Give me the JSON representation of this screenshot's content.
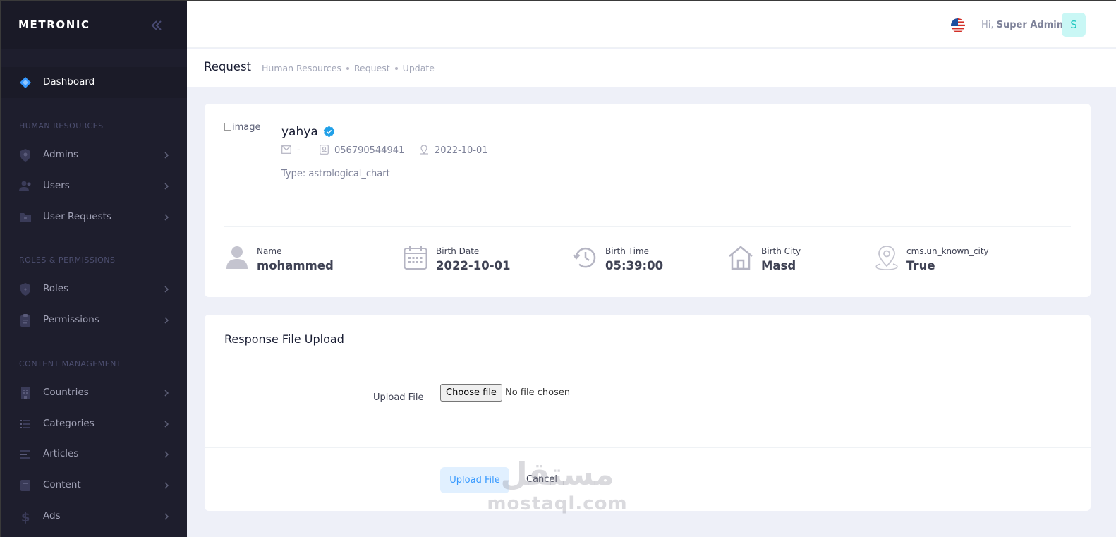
{
  "sidebar": {
    "brand": "METRONIC",
    "dashboard": "Dashboard",
    "sections": {
      "hr": "HUMAN RESOURCES",
      "roles": "ROLES & PERMISSIONS",
      "content": "CONTENT MANAGEMENT"
    },
    "items": {
      "admins": "Admins",
      "users": "Users",
      "user_requests": "User Requests",
      "roles": "Roles",
      "permissions": "Permissions",
      "countries": "Countries",
      "categories": "Categories",
      "articles": "Articles",
      "content": "Content",
      "ads": "Ads"
    }
  },
  "header": {
    "greet_prefix": "Hi,",
    "user_name": "Super Admin",
    "avatar_letter": "S"
  },
  "toolbar": {
    "title": "Request",
    "breadcrumbs": [
      "Human Resources",
      "Request",
      "Update"
    ]
  },
  "profile": {
    "image_alt": "image",
    "name": "yahya",
    "email": "-",
    "phone": "056790544941",
    "date": "2022-10-01",
    "type_label": "Type:",
    "type_value": "astrological_chart"
  },
  "stats": [
    {
      "label": "Name",
      "value": "mohammed",
      "icon": "person-icon"
    },
    {
      "label": "Birth Date",
      "value": "2022-10-01",
      "icon": "calendar-icon"
    },
    {
      "label": "Birth Time",
      "value": "05:39:00",
      "icon": "history-icon"
    },
    {
      "label": "Birth City",
      "value": "Masd",
      "icon": "home-icon"
    },
    {
      "label": "cms.un_known_city",
      "value": "True",
      "icon": "location-icon"
    }
  ],
  "upload": {
    "title": "Response File Upload",
    "field_label": "Upload File",
    "choose_label": "Choose file",
    "no_file": "No file chosen",
    "submit_label": "Upload File",
    "cancel_label": "Cancel"
  },
  "watermark": {
    "arabic": "مستقل",
    "latin": "mostaql.com"
  },
  "colors": {
    "sidebar_bg": "#1e1e2d",
    "accent": "#3699ff",
    "verified": "#20a0e8"
  }
}
